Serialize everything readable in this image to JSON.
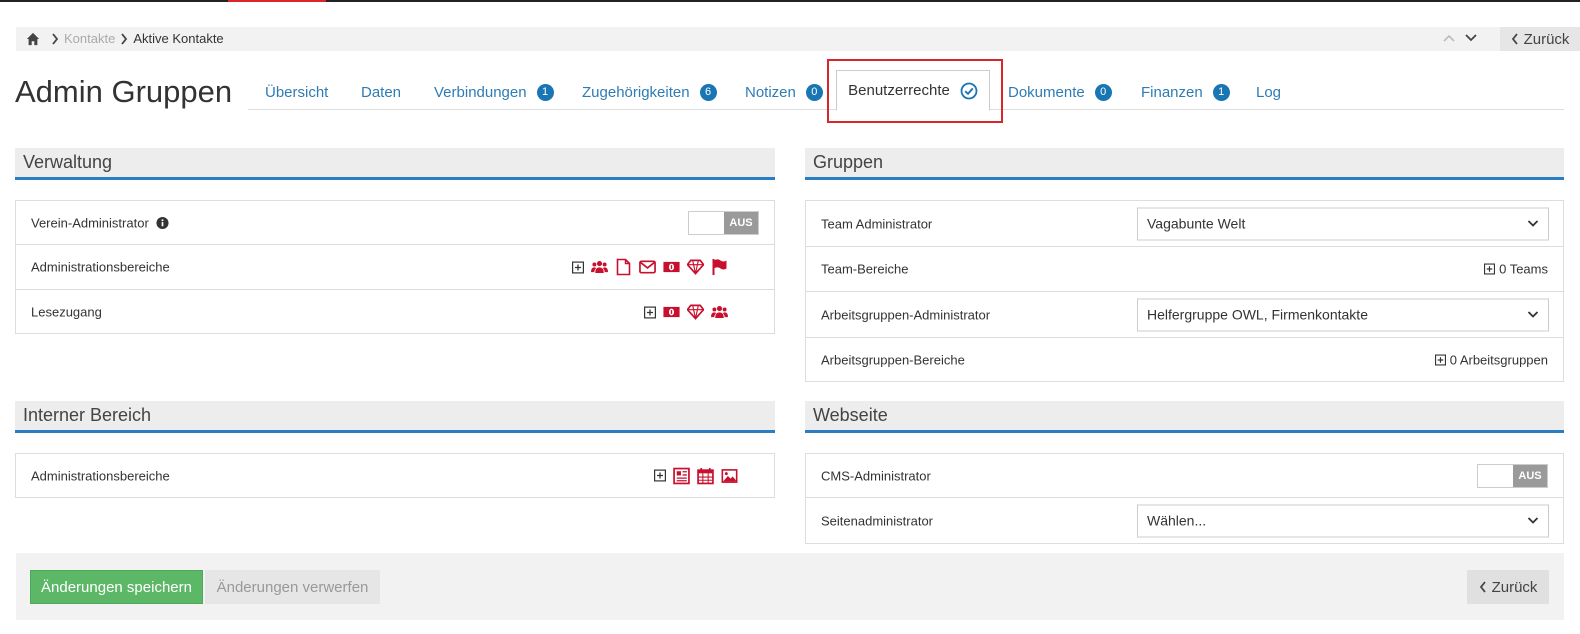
{
  "breadcrumb": {
    "items": [
      "Kontakte",
      "Aktive Kontakte"
    ]
  },
  "header": {
    "back_label": "Zurück",
    "title": "Admin Gruppen"
  },
  "tabs": [
    {
      "label": "Übersicht"
    },
    {
      "label": "Daten"
    },
    {
      "label": "Verbindungen",
      "badge": "1"
    },
    {
      "label": "Zugehörigkeiten",
      "badge": "6"
    },
    {
      "label": "Notizen",
      "badge": "0"
    },
    {
      "label": "Benutzerrechte",
      "active": true
    },
    {
      "label": "Dokumente",
      "badge": "0"
    },
    {
      "label": "Finanzen",
      "badge": "1"
    },
    {
      "label": "Log"
    }
  ],
  "verwaltung": {
    "title": "Verwaltung",
    "rows": [
      {
        "label": "Verein-Administrator",
        "toggle": "AUS"
      },
      {
        "label": "Administrationsbereiche"
      },
      {
        "label": "Lesezugang"
      }
    ]
  },
  "gruppen": {
    "title": "Gruppen",
    "rows": [
      {
        "label": "Team Administrator",
        "value": "Vagabunte Welt"
      },
      {
        "label": "Team-Bereiche",
        "count": "0 Teams"
      },
      {
        "label": "Arbeitsgruppen-Administrator",
        "value": "Helfergruppe OWL, Firmenkontakte"
      },
      {
        "label": "Arbeitsgruppen-Bereiche",
        "count": "0 Arbeitsgruppen"
      }
    ]
  },
  "intern": {
    "title": "Interner Bereich",
    "rows": [
      {
        "label": "Administrationsbereiche"
      }
    ]
  },
  "webseite": {
    "title": "Webseite",
    "rows": [
      {
        "label": "CMS-Administrator",
        "toggle": "AUS"
      },
      {
        "label": "Seitenadministrator",
        "value": "Wählen..."
      }
    ]
  },
  "footer": {
    "save_label": "Änderungen speichern",
    "discard_label": "Änderungen verwerfen",
    "back_label": "Zurück"
  },
  "colors": {
    "accent_blue": "#2a7dc1",
    "icon_red": "#c8102e",
    "save_green": "#5cb867",
    "highlight_red": "#d9262c"
  }
}
